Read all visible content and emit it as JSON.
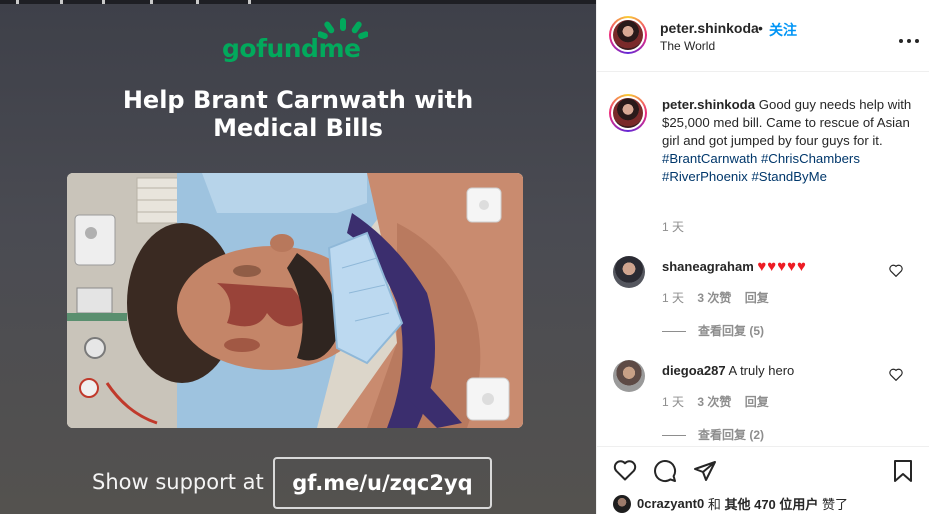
{
  "post_image": {
    "logo_text": "gofundme",
    "headline": "Help Brant Carnwath with\nMedical Bills",
    "support_label": "Show support at",
    "support_link": "gf.me/u/zqc2yq"
  },
  "header": {
    "username": "peter.shinkoda",
    "separator": "•",
    "follow_label": "关注",
    "location": "The World",
    "more_icon": "more-horizontal-icon"
  },
  "caption": {
    "username": "peter.shinkoda",
    "text": "Good guy needs help with $25,000 med bill. Came to rescue of Asian girl and got jumped by four guys for it.",
    "hashtags": [
      "#BrantCarnwath",
      "#ChrisChambers",
      "#RiverPhoenix",
      "#StandByMe"
    ],
    "time": "1 天"
  },
  "comments": [
    {
      "username": "shaneagraham",
      "text": "♥♥♥♥♥",
      "time": "1 天",
      "likes": "3 次赞",
      "reply_label": "回复",
      "view_replies": "查看回复 (5)"
    },
    {
      "username": "diegoa287",
      "text": "A truly hero",
      "time": "1 天",
      "likes": "3 次赞",
      "reply_label": "回复",
      "view_replies": "查看回复 (2)"
    }
  ],
  "actions": {
    "like_icon": "heart-icon",
    "comment_icon": "comment-icon",
    "share_icon": "share-icon",
    "save_icon": "bookmark-icon"
  },
  "likes": {
    "user": "0crazyant0",
    "and": "和",
    "others": "其他 470 位用户",
    "suffix": "赞了"
  },
  "colors": {
    "gofundme_green": "#02a95c",
    "link_blue": "#0095f6",
    "hashtag_blue": "#00376b",
    "heart_red": "#ed1c24",
    "muted": "#8e8e8e"
  }
}
